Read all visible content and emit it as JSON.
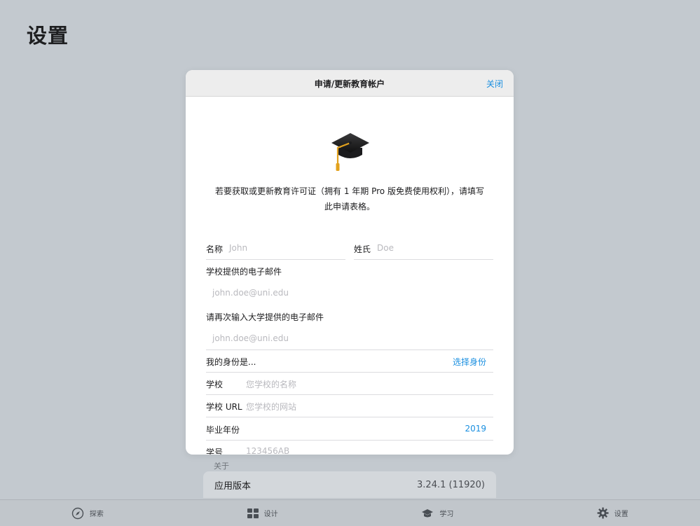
{
  "page": {
    "title": "设置"
  },
  "modal": {
    "title": "申请/更新教育帐户",
    "close_label": "关闭",
    "intro_line1": "若要获取或更新教育许可证（拥有 1 年期 Pro 版免费使用权利），请填写",
    "intro_line2": "此申请表格。",
    "icon": "graduation-cap-icon"
  },
  "form": {
    "first_name": {
      "label": "名称",
      "placeholder": "John"
    },
    "last_name": {
      "label": "姓氏",
      "placeholder": "Doe"
    },
    "school_email": {
      "label": "学校提供的电子邮件",
      "placeholder": "john.doe@uni.edu"
    },
    "confirm_email": {
      "label": "请再次输入大学提供的电子邮件",
      "placeholder": "john.doe@uni.edu"
    },
    "identity": {
      "label": "我的身份是...",
      "action": "选择身份"
    },
    "school": {
      "label": "学校",
      "placeholder": "您学校的名称"
    },
    "school_url": {
      "label": "学校 URL",
      "placeholder": "您学校的网站"
    },
    "grad_year": {
      "label": "毕业年份",
      "value": "2019"
    },
    "student_id": {
      "label": "学号",
      "placeholder": "123456AB"
    }
  },
  "background": {
    "section_label": "关于",
    "version_label": "应用版本",
    "version_value": "3.24.1 (11920)"
  },
  "tabbar": {
    "items": [
      {
        "label": "探索",
        "icon": "compass-icon"
      },
      {
        "label": "设计",
        "icon": "grid-icon"
      },
      {
        "label": "学习",
        "icon": "graduation-cap-icon"
      },
      {
        "label": "设置",
        "icon": "gear-icon"
      }
    ]
  },
  "colors": {
    "accent": "#1a8fe0",
    "backdrop": "#c3c9cf"
  }
}
